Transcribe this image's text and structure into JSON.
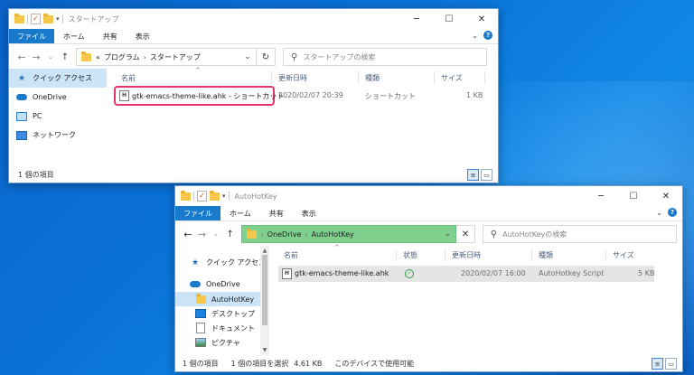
{
  "win1": {
    "title": "スタートアップ",
    "ribbon_tabs": [
      "ファイル",
      "ホーム",
      "共有",
      "表示"
    ],
    "breadcrumb": [
      "«",
      "プログラム",
      "スタートアップ"
    ],
    "search_placeholder": "スタートアップの検索",
    "nav_items": [
      "クイック アクセス",
      "OneDrive",
      "PC",
      "ネットワーク"
    ],
    "columns": [
      "名前",
      "更新日時",
      "種類",
      "サイズ"
    ],
    "file": {
      "name": "gtk-emacs-theme-like.ahk - ショートカット",
      "modified": "2020/02/07 20:39",
      "type": "ショートカット",
      "size": "1 KB"
    },
    "status": "1 個の項目"
  },
  "win2": {
    "title": "AutoHotKey",
    "ribbon_tabs": [
      "ファイル",
      "ホーム",
      "共有",
      "表示"
    ],
    "breadcrumb": [
      "OneDrive",
      "AutoHotKey"
    ],
    "search_placeholder": "AutoHotKeyの検索",
    "nav_items": [
      "クイック アクセス",
      "OneDrive",
      "AutoHotKey",
      "デスクトップ",
      "ドキュメント",
      "ピクチャ"
    ],
    "columns": [
      "名前",
      "状態",
      "更新日時",
      "種類",
      "サイズ"
    ],
    "file": {
      "name": "gtk-emacs-theme-like.ahk",
      "modified": "2020/02/07 16:00",
      "type": "AutoHotkey Script",
      "size": "5 KB"
    },
    "status_count": "1 個の項目",
    "status_selected": "1 個の項目を選択",
    "status_size": "4.61 KB",
    "status_avail": "このデバイスで使用可能"
  },
  "colors": {
    "accent": "#1979ca",
    "highlight_border": "#e8336b",
    "address_highlight": "#7fd08c",
    "selected_row": "#e5e5e5"
  }
}
